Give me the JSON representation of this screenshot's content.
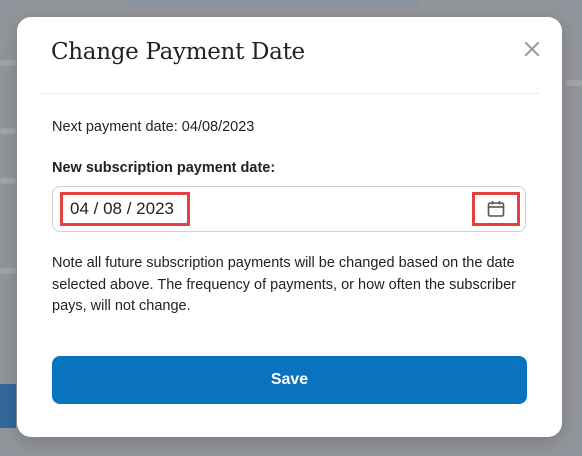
{
  "modal": {
    "title": "Change Payment Date",
    "close_icon": "close-icon",
    "next_payment": {
      "label": "Next payment date:",
      "value": "04/08/2023"
    },
    "new_date": {
      "label": "New subscription payment date:",
      "value": "04 / 08 / 2023",
      "calendar_icon": "calendar-icon"
    },
    "note": "Note all future subscription payments will be changed based on the date selected above. The frequency of payments, or how often the subscriber pays, will not change.",
    "save_label": "Save"
  },
  "colors": {
    "primary": "#0a73c0",
    "highlight": "#e0433f"
  }
}
